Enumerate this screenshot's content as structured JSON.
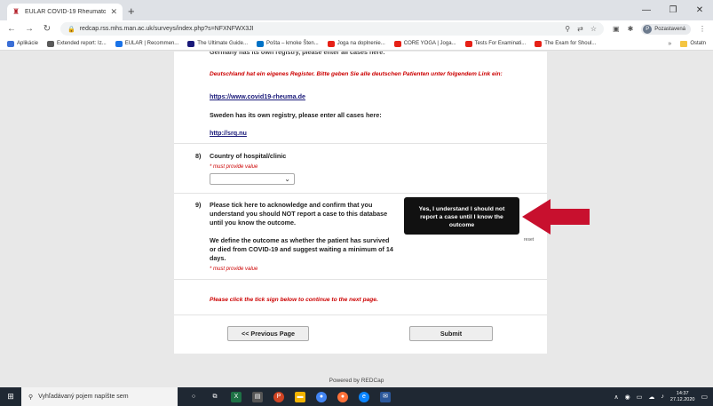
{
  "browser": {
    "tab_title": "EULAR COVID-19 Rheumatologic",
    "url": "redcap.rss.mhs.man.ac.uk/surveys/index.php?s=NFXNFWX3JI",
    "profile_name": "Pozastavená",
    "profile_initial": "P"
  },
  "bookmarks": [
    {
      "label": "Aplikácie",
      "icon_color": "#3b6fd6"
    },
    {
      "label": "Extended report: Iz...",
      "icon_color": "#5a5a5a"
    },
    {
      "label": "EULAR | Recommen...",
      "icon_color": "#1a73e8"
    },
    {
      "label": "The Ultimate Guide...",
      "icon_color": "#1a1a7a"
    },
    {
      "label": "Pošta – kmoke Šten...",
      "icon_color": "#0072c6"
    },
    {
      "label": "Joga na doplnenie...",
      "icon_color": "#e62117"
    },
    {
      "label": "CORE YOGA | Joga...",
      "icon_color": "#e62117"
    },
    {
      "label": "Tests For Examinati...",
      "icon_color": "#e62117"
    },
    {
      "label": "The Exam for Shoul...",
      "icon_color": "#e62117"
    }
  ],
  "bookmarks_more": "»",
  "bookmarks_other": "Ostatn",
  "survey": {
    "top_cut_text": "Germany has its own registry, please enter all cases here:",
    "germany_note": "Deutschland hat ein eigenes Register. Bitte geben Sie alle deutschen Patienten unter folgendem Link ein:",
    "germany_link": "https://www.covid19-rheuma.de",
    "sweden_text": "Sweden has its own registry, please enter all cases here:",
    "sweden_link": "http://srq.nu",
    "q8_num": "8)",
    "q8_label": "Country of hospital/clinic",
    "required": "* must provide value",
    "q9_num": "9)",
    "q9_label": "Please tick here to acknowledge and confirm that you understand you should NOT report a case to this database until you know the outcome.",
    "q9_detail": "We define the outcome as whether the patient has survived or died from COVID-19 and suggest waiting a minimum of 14 days.",
    "reset": "reset",
    "tooltip": "Yes, I understand I should not report a case until I know the outcome",
    "tick_note": "Please click the tick sign below to continue to the next page.",
    "prev_button": "<< Previous Page",
    "submit_button": "Submit"
  },
  "powered_by": "Powered by REDCap",
  "taskbar": {
    "search_placeholder": "Vyhľadávaný pojem napíšte sem",
    "time": "14:37",
    "date": "27.12.2020"
  },
  "colors": {
    "arrow": "#c8102e",
    "required": "#cc0000",
    "link": "#1a1a7a"
  }
}
